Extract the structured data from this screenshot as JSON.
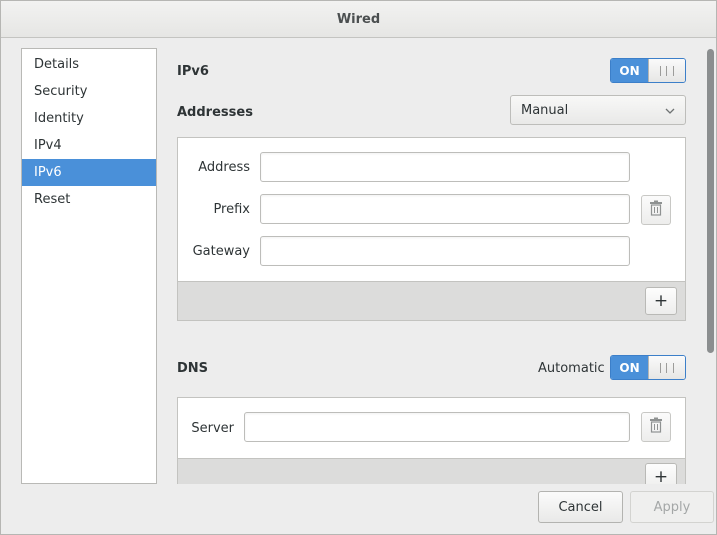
{
  "window": {
    "title": "Wired"
  },
  "sidebar": {
    "items": [
      {
        "label": "Details",
        "active": false
      },
      {
        "label": "Security",
        "active": false
      },
      {
        "label": "Identity",
        "active": false
      },
      {
        "label": "IPv4",
        "active": false
      },
      {
        "label": "IPv6",
        "active": true
      },
      {
        "label": "Reset",
        "active": false
      }
    ]
  },
  "ipv6": {
    "title": "IPv6",
    "switch_label": "ON",
    "switch_state": true,
    "addresses_label": "Addresses",
    "method_selected": "Manual",
    "fields": {
      "address_label": "Address",
      "address_value": "",
      "prefix_label": "Prefix",
      "prefix_value": "",
      "gateway_label": "Gateway",
      "gateway_value": ""
    },
    "add_label": "+"
  },
  "dns": {
    "title": "DNS",
    "automatic_label": "Automatic",
    "switch_label": "ON",
    "switch_state": true,
    "server_label": "Server",
    "server_value": "",
    "add_label": "+"
  },
  "buttons": {
    "cancel": "Cancel",
    "apply": "Apply"
  },
  "icons": {
    "delete": "trash-icon",
    "dropdown": "chevron-down-icon",
    "switch_grip": "grip-icon"
  },
  "colors": {
    "accent": "#4a90d9"
  }
}
